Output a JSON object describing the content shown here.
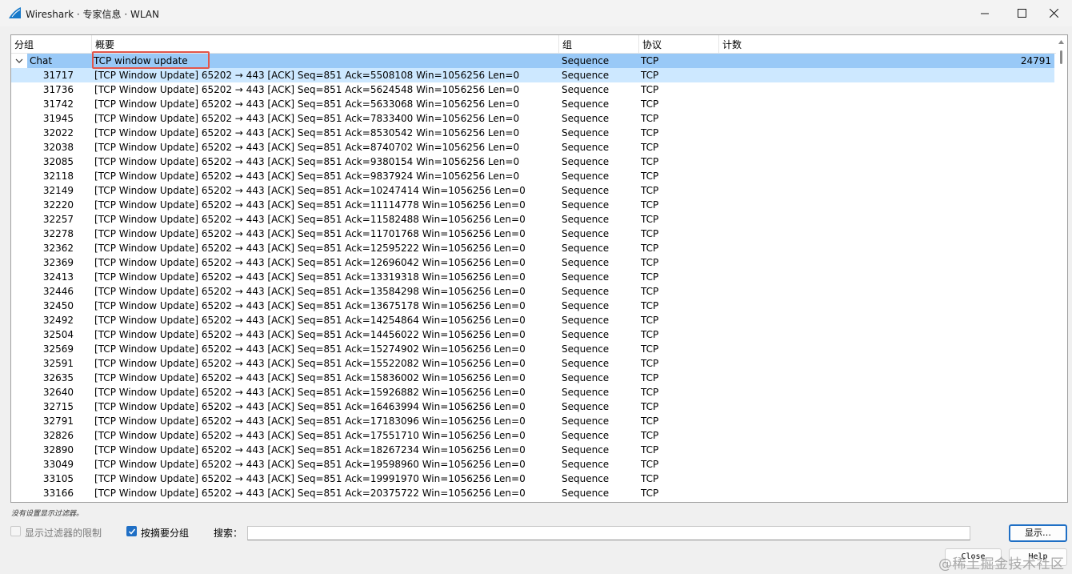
{
  "window": {
    "title": "Wireshark · 专家信息 · WLAN"
  },
  "table": {
    "headers": [
      "分组",
      "概要",
      "组",
      "协议",
      "计数"
    ],
    "group_row": {
      "expander": "Chat",
      "summary": "TCP window update",
      "group": "Sequence",
      "protocol": "TCP",
      "count": "24791"
    },
    "rows": [
      {
        "packet": "31717",
        "summary": "[TCP Window Update] 65202 → 443 [ACK] Seq=851 Ack=5508108 Win=1056256 Len=0",
        "group": "Sequence",
        "protocol": "TCP"
      },
      {
        "packet": "31736",
        "summary": "[TCP Window Update] 65202 → 443 [ACK] Seq=851 Ack=5624548 Win=1056256 Len=0",
        "group": "Sequence",
        "protocol": "TCP"
      },
      {
        "packet": "31742",
        "summary": "[TCP Window Update] 65202 → 443 [ACK] Seq=851 Ack=5633068 Win=1056256 Len=0",
        "group": "Sequence",
        "protocol": "TCP"
      },
      {
        "packet": "31945",
        "summary": "[TCP Window Update] 65202 → 443 [ACK] Seq=851 Ack=7833400 Win=1056256 Len=0",
        "group": "Sequence",
        "protocol": "TCP"
      },
      {
        "packet": "32022",
        "summary": "[TCP Window Update] 65202 → 443 [ACK] Seq=851 Ack=8530542 Win=1056256 Len=0",
        "group": "Sequence",
        "protocol": "TCP"
      },
      {
        "packet": "32038",
        "summary": "[TCP Window Update] 65202 → 443 [ACK] Seq=851 Ack=8740702 Win=1056256 Len=0",
        "group": "Sequence",
        "protocol": "TCP"
      },
      {
        "packet": "32085",
        "summary": "[TCP Window Update] 65202 → 443 [ACK] Seq=851 Ack=9380154 Win=1056256 Len=0",
        "group": "Sequence",
        "protocol": "TCP"
      },
      {
        "packet": "32118",
        "summary": "[TCP Window Update] 65202 → 443 [ACK] Seq=851 Ack=9837924 Win=1056256 Len=0",
        "group": "Sequence",
        "protocol": "TCP"
      },
      {
        "packet": "32149",
        "summary": "[TCP Window Update] 65202 → 443 [ACK] Seq=851 Ack=10247414 Win=1056256 Len=0",
        "group": "Sequence",
        "protocol": "TCP"
      },
      {
        "packet": "32220",
        "summary": "[TCP Window Update] 65202 → 443 [ACK] Seq=851 Ack=11114778 Win=1056256 Len=0",
        "group": "Sequence",
        "protocol": "TCP"
      },
      {
        "packet": "32257",
        "summary": "[TCP Window Update] 65202 → 443 [ACK] Seq=851 Ack=11582488 Win=1056256 Len=0",
        "group": "Sequence",
        "protocol": "TCP"
      },
      {
        "packet": "32278",
        "summary": "[TCP Window Update] 65202 → 443 [ACK] Seq=851 Ack=11701768 Win=1056256 Len=0",
        "group": "Sequence",
        "protocol": "TCP"
      },
      {
        "packet": "32362",
        "summary": "[TCP Window Update] 65202 → 443 [ACK] Seq=851 Ack=12595222 Win=1056256 Len=0",
        "group": "Sequence",
        "protocol": "TCP"
      },
      {
        "packet": "32369",
        "summary": "[TCP Window Update] 65202 → 443 [ACK] Seq=851 Ack=12696042 Win=1056256 Len=0",
        "group": "Sequence",
        "protocol": "TCP"
      },
      {
        "packet": "32413",
        "summary": "[TCP Window Update] 65202 → 443 [ACK] Seq=851 Ack=13319318 Win=1056256 Len=0",
        "group": "Sequence",
        "protocol": "TCP"
      },
      {
        "packet": "32446",
        "summary": "[TCP Window Update] 65202 → 443 [ACK] Seq=851 Ack=13584298 Win=1056256 Len=0",
        "group": "Sequence",
        "protocol": "TCP"
      },
      {
        "packet": "32450",
        "summary": "[TCP Window Update] 65202 → 443 [ACK] Seq=851 Ack=13675178 Win=1056256 Len=0",
        "group": "Sequence",
        "protocol": "TCP"
      },
      {
        "packet": "32492",
        "summary": "[TCP Window Update] 65202 → 443 [ACK] Seq=851 Ack=14254864 Win=1056256 Len=0",
        "group": "Sequence",
        "protocol": "TCP"
      },
      {
        "packet": "32504",
        "summary": "[TCP Window Update] 65202 → 443 [ACK] Seq=851 Ack=14456022 Win=1056256 Len=0",
        "group": "Sequence",
        "protocol": "TCP"
      },
      {
        "packet": "32569",
        "summary": "[TCP Window Update] 65202 → 443 [ACK] Seq=851 Ack=15274902 Win=1056256 Len=0",
        "group": "Sequence",
        "protocol": "TCP"
      },
      {
        "packet": "32591",
        "summary": "[TCP Window Update] 65202 → 443 [ACK] Seq=851 Ack=15522082 Win=1056256 Len=0",
        "group": "Sequence",
        "protocol": "TCP"
      },
      {
        "packet": "32635",
        "summary": "[TCP Window Update] 65202 → 443 [ACK] Seq=851 Ack=15836002 Win=1056256 Len=0",
        "group": "Sequence",
        "protocol": "TCP"
      },
      {
        "packet": "32640",
        "summary": "[TCP Window Update] 65202 → 443 [ACK] Seq=851 Ack=15926882 Win=1056256 Len=0",
        "group": "Sequence",
        "protocol": "TCP"
      },
      {
        "packet": "32715",
        "summary": "[TCP Window Update] 65202 → 443 [ACK] Seq=851 Ack=16463994 Win=1056256 Len=0",
        "group": "Sequence",
        "protocol": "TCP"
      },
      {
        "packet": "32791",
        "summary": "[TCP Window Update] 65202 → 443 [ACK] Seq=851 Ack=17183096 Win=1056256 Len=0",
        "group": "Sequence",
        "protocol": "TCP"
      },
      {
        "packet": "32826",
        "summary": "[TCP Window Update] 65202 → 443 [ACK] Seq=851 Ack=17551710 Win=1056256 Len=0",
        "group": "Sequence",
        "protocol": "TCP"
      },
      {
        "packet": "32890",
        "summary": "[TCP Window Update] 65202 → 443 [ACK] Seq=851 Ack=18267234 Win=1056256 Len=0",
        "group": "Sequence",
        "protocol": "TCP"
      },
      {
        "packet": "33049",
        "summary": "[TCP Window Update] 65202 → 443 [ACK] Seq=851 Ack=19598960 Win=1056256 Len=0",
        "group": "Sequence",
        "protocol": "TCP"
      },
      {
        "packet": "33105",
        "summary": "[TCP Window Update] 65202 → 443 [ACK] Seq=851 Ack=19991970 Win=1056256 Len=0",
        "group": "Sequence",
        "protocol": "TCP"
      },
      {
        "packet": "33166",
        "summary": "[TCP Window Update] 65202 → 443 [ACK] Seq=851 Ack=20375722 Win=1056256 Len=0",
        "group": "Sequence",
        "protocol": "TCP"
      }
    ]
  },
  "status_text": "没有设置显示过滤器。",
  "controls": {
    "limit_to_filter_label": "显示过滤器的限制",
    "limit_to_filter_checked": false,
    "group_by_summary_label": "按摘要分组",
    "group_by_summary_checked": true,
    "search_label": "搜索：",
    "search_value": "",
    "show_button": "显示…",
    "close_button": "Close",
    "help_button": "Help"
  },
  "watermark": "@稀土掘金技术社区",
  "colors": {
    "selected_row": "#99c9f7",
    "hover_row": "#cde8ff",
    "highlight_box": "#e2564a",
    "accent": "#1f6fc5"
  },
  "icons": {
    "app": "wireshark-fin-icon",
    "window": [
      "minimize-icon",
      "maximize-icon",
      "close-icon"
    ],
    "expander": "chevron-down-icon"
  }
}
